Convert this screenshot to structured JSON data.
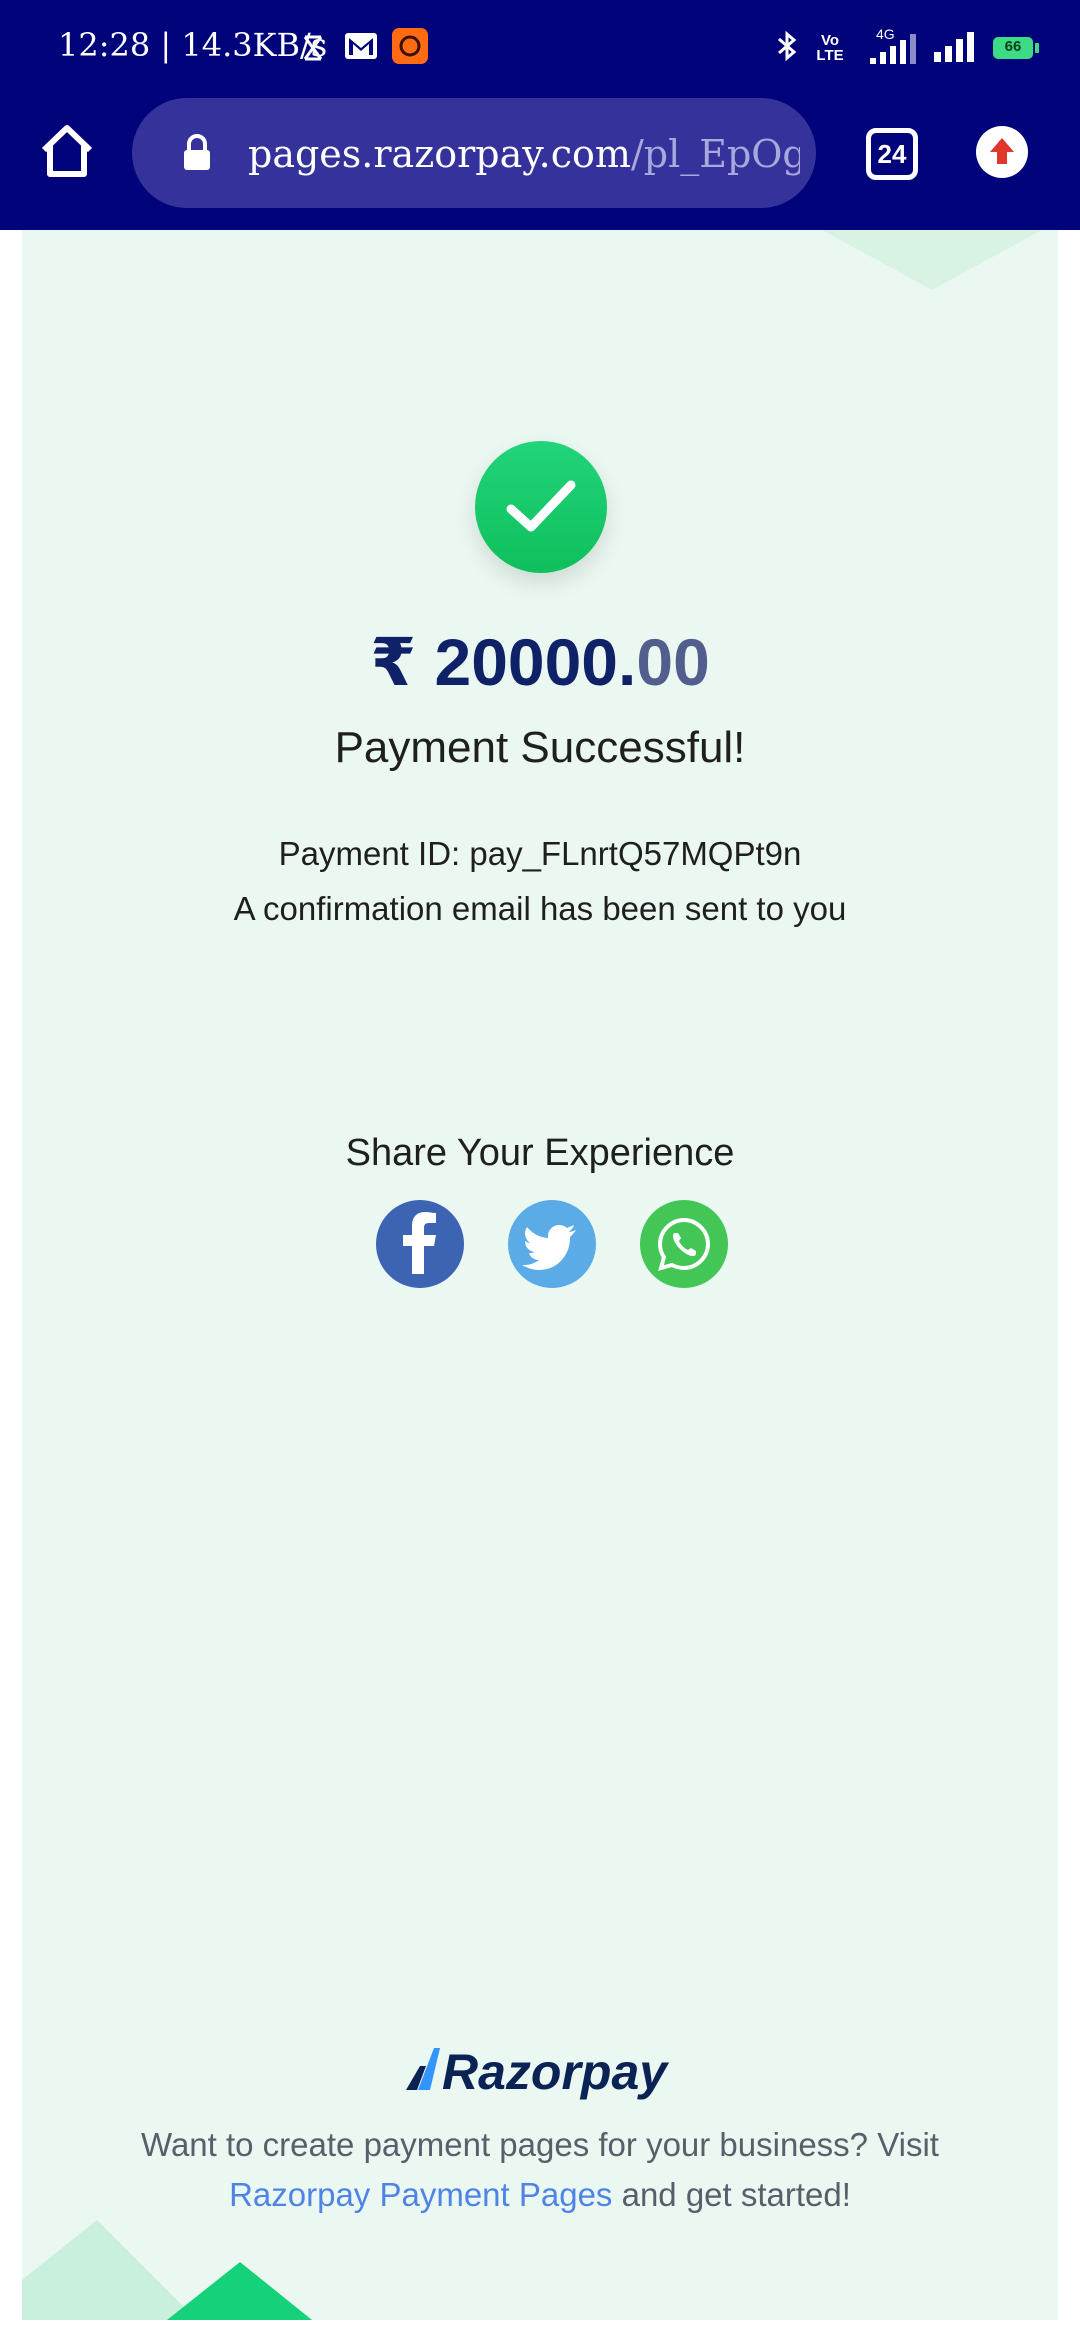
{
  "status_bar": {
    "time_speed": "12:28 | 14.3KB/s",
    "battery_level": "66",
    "network_label_1": "4G",
    "volte_label_top": "Vo",
    "volte_label_bottom": "LTE"
  },
  "browser": {
    "url_host": "pages.razorpay.com",
    "url_path": "/pl_EpOg",
    "tab_count": "24"
  },
  "payment": {
    "currency_symbol": "₹",
    "amount_whole": "20000.",
    "amount_decimal": "00",
    "status_title": "Payment Successful!",
    "payment_id": "Payment ID: pay_FLnrtQ57MQPt9n",
    "confirmation": "A confirmation email has been sent to you"
  },
  "share": {
    "title": "Share Your Experience",
    "buttons": [
      "facebook-icon",
      "twitter-icon",
      "whatsapp-icon"
    ]
  },
  "footer": {
    "brand": "Razorpay",
    "line1": "Want to create payment pages for your business? Visit",
    "link_text": "Razorpay Payment Pages",
    "line2_suffix": " and get started!"
  },
  "colors": {
    "header_bg": "#00037a",
    "url_bar_bg": "#35339b",
    "page_bg": "#ebf8f1",
    "success_green": "#18c86a",
    "amount_color": "#0f2167",
    "link_color": "#4f84e6"
  }
}
